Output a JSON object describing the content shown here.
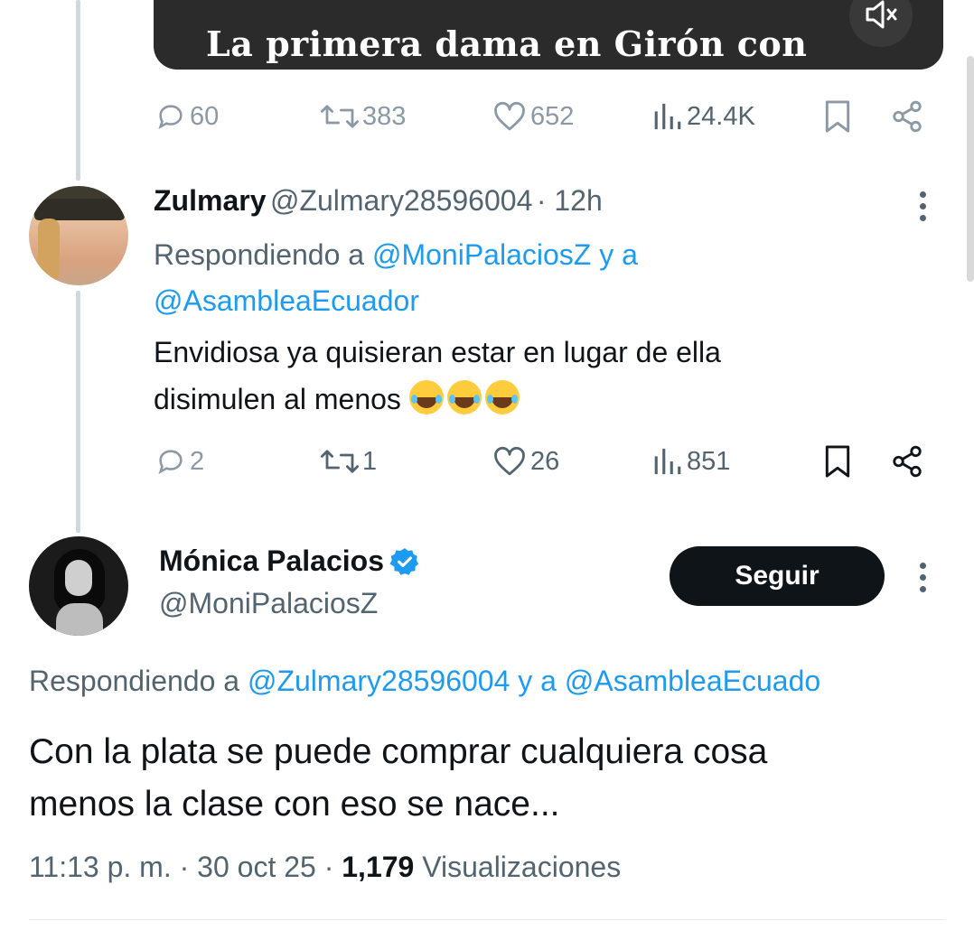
{
  "video": {
    "caption": "La primera dama en Girón con",
    "mute_icon": "speaker-muted-icon"
  },
  "tweet1_actions": {
    "replies": "60",
    "retweets": "383",
    "likes": "652",
    "views": "24.4K"
  },
  "reply": {
    "name": "Zulmary",
    "handle": "@Zulmary28596004",
    "time": "· 12h",
    "replying_prefix": "Respondiendo a",
    "replying_user1": "@MoniPalaciosZ",
    "replying_join": "y a",
    "replying_user2": "@AsambleaEcuador",
    "text_line1": "Envidiosa ya quisieran estar en lugar de ella",
    "text_line2": "disimulen al menos",
    "actions": {
      "replies": "2",
      "retweets": "1",
      "likes": "26",
      "views": "851"
    }
  },
  "main_tweet": {
    "name": "Mónica Palacios",
    "handle": "@MoniPalaciosZ",
    "follow_label": "Seguir",
    "replying_prefix": "Respondiendo a",
    "replying_user1": "@Zulmary28596004",
    "replying_join": "y a",
    "replying_user2": "@AsambleaEcuado",
    "text_line1": "Con la plata se puede comprar cualquiera cosa",
    "text_line2": "menos la clase con eso se nace...",
    "time": "11:13 p. m.",
    "sep1": "·",
    "date": "30 oct 25",
    "sep2": "·",
    "views_count": "1,179",
    "views_label": "Visualizaciones"
  },
  "colors": {
    "accent": "#1d9bf0",
    "text": "#0f1419",
    "muted": "#536471",
    "button": "#0f1419"
  }
}
